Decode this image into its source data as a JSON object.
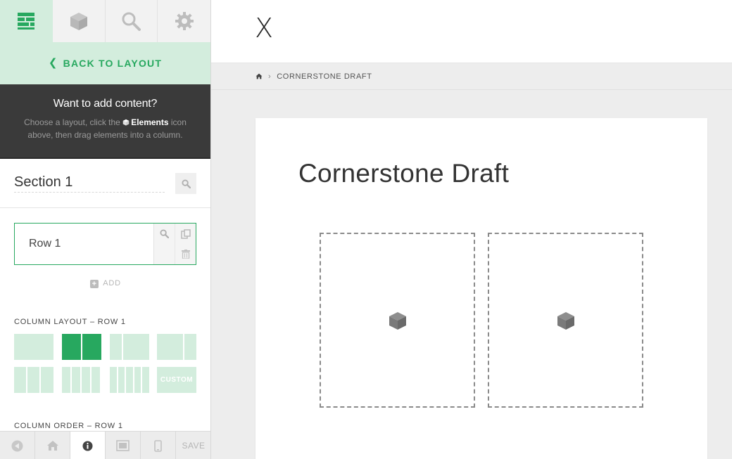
{
  "sidebar": {
    "tabs": [
      {
        "icon": "layout-icon",
        "active": true
      },
      {
        "icon": "elements-cube-icon",
        "active": false
      },
      {
        "icon": "search-icon",
        "active": false
      },
      {
        "icon": "settings-gear-icon",
        "active": false
      }
    ],
    "back_label": "BACK TO LAYOUT",
    "info": {
      "title": "Want to add content?",
      "text_before": "Choose a layout, click the",
      "text_bold": "Elements",
      "text_after": "icon above, then drag elements into a column."
    },
    "section_title": "Section 1",
    "row_label": "Row 1",
    "add_label": "ADD",
    "column_layout_label": "COLUMN LAYOUT – ROW 1",
    "layout_options": [
      {
        "id": "1",
        "active": false
      },
      {
        "id": "1/2+1/2",
        "active": true
      },
      {
        "id": "1/3+2/3",
        "active": false
      },
      {
        "id": "2/3+1/3",
        "active": false
      },
      {
        "id": "1/3x3",
        "active": false
      },
      {
        "id": "1/4x4",
        "active": false
      },
      {
        "id": "1/5x5",
        "active": false
      },
      {
        "id": "custom",
        "label": "CUSTOM",
        "active": false
      }
    ],
    "column_order_label": "COLUMN ORDER – ROW 1",
    "bottom_bar": {
      "items": [
        "collapse-icon",
        "home-icon",
        "info-icon",
        "responsive-icon",
        "mobile-icon"
      ],
      "save_label": "SAVE"
    },
    "accent_color": "#27a85f",
    "accent_light": "#d3eddd"
  },
  "main": {
    "logo": "X",
    "breadcrumb": {
      "home_icon": "home-icon",
      "current": "CORNERSTONE DRAFT"
    },
    "page_title": "Cornerstone Draft",
    "columns": 2
  }
}
